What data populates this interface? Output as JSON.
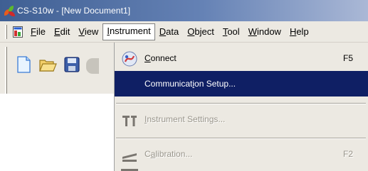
{
  "window": {
    "title": "CS-S10w - [New Document1]"
  },
  "menubar": {
    "items": [
      {
        "label": "File",
        "mnemonic_index": 0
      },
      {
        "label": "Edit",
        "mnemonic_index": 0
      },
      {
        "label": "View",
        "mnemonic_index": 0
      },
      {
        "label": "Instrument",
        "mnemonic_index": 0
      },
      {
        "label": "Data",
        "mnemonic_index": 0
      },
      {
        "label": "Object",
        "mnemonic_index": 0
      },
      {
        "label": "Tool",
        "mnemonic_index": 0
      },
      {
        "label": "Window",
        "mnemonic_index": 0
      },
      {
        "label": "Help",
        "mnemonic_index": 0
      }
    ],
    "active_index": 3
  },
  "toolbar": {
    "buttons": [
      "new-document-icon",
      "open-folder-icon",
      "save-disk-icon"
    ]
  },
  "instrument_menu": {
    "items": [
      {
        "label": "Connect",
        "mnemonic_index": 0,
        "shortcut": "F5",
        "icon": "connect-plug-icon",
        "state": "normal"
      },
      {
        "label": "Communication Setup...",
        "mnemonic_index": 10,
        "shortcut": "",
        "icon": "",
        "state": "highlighted"
      },
      {
        "label": "Instrument Settings...",
        "mnemonic_index": 0,
        "shortcut": "",
        "icon": "instrument-settings-icon",
        "state": "disabled"
      },
      {
        "label": "Calibration...",
        "mnemonic_index": 1,
        "shortcut": "F2",
        "icon": "calibration-icon",
        "state": "disabled"
      }
    ]
  },
  "colors": {
    "title_bar": "#4a6aa0",
    "menu_highlight": "#0f1f64",
    "menu_bg": "#ece9e2",
    "disabled_text": "#9a968c"
  }
}
